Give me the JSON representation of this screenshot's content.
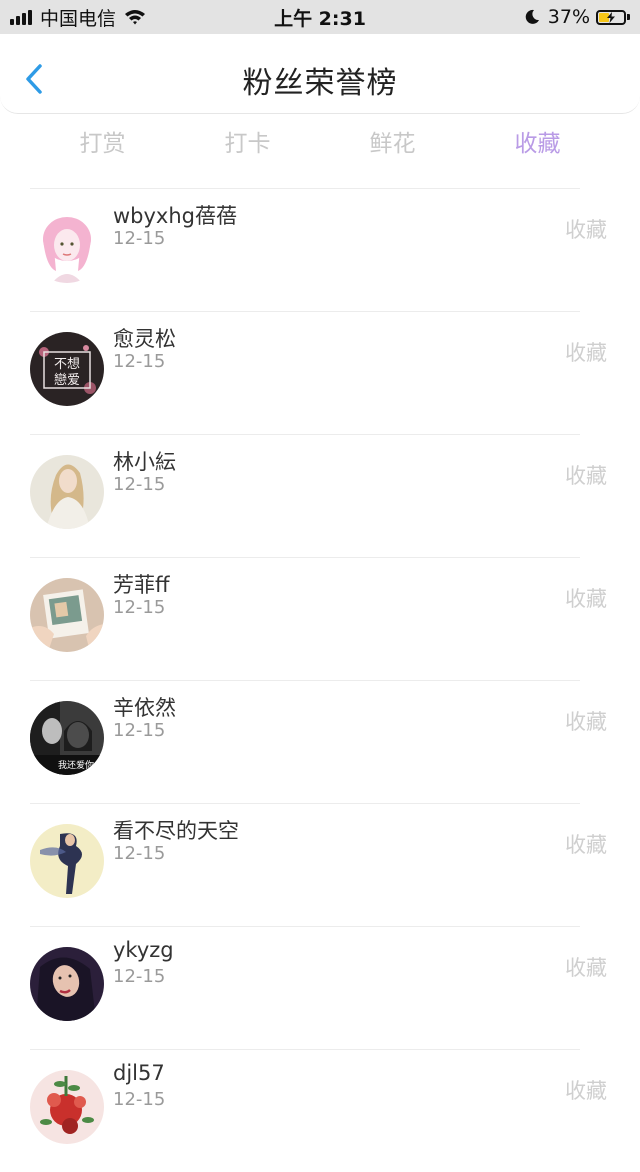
{
  "status_bar": {
    "carrier": "中国电信",
    "time": "上午 2:31",
    "battery": "37%",
    "battery_level": 0.37,
    "icons": [
      "signal-icon",
      "wifi-icon",
      "moon-icon",
      "battery-icon"
    ]
  },
  "header": {
    "title": "粉丝荣誉榜",
    "back_icon": "chevron-left-icon"
  },
  "tabs": [
    {
      "label": "打赏",
      "active": false
    },
    {
      "label": "打卡",
      "active": false
    },
    {
      "label": "鲜花",
      "active": false
    },
    {
      "label": "收藏",
      "active": true
    }
  ],
  "colors": {
    "accent": "#b99be6",
    "back_icon": "#2e9be6",
    "tab_inactive": "#c8c8c8",
    "date_text": "#9a9a9a",
    "action_text": "#cfcfcf"
  },
  "fans": [
    {
      "name": "wbyxhg蓓蓓",
      "date": "12-15",
      "action": "收藏",
      "avatar": "avatar-illustrated-pink-hair"
    },
    {
      "name": "愈灵松",
      "date": "12-15",
      "action": "收藏",
      "avatar": "avatar-text-image",
      "avatar_text_1": "不想",
      "avatar_text_2": "戀爱"
    },
    {
      "name": "林小紜",
      "date": "12-15",
      "action": "收藏",
      "avatar": "avatar-photo-woman-blonde"
    },
    {
      "name": "芳菲ff",
      "date": "12-15",
      "action": "收藏",
      "avatar": "avatar-photo-polaroid"
    },
    {
      "name": "辛依然",
      "date": "12-15",
      "action": "收藏",
      "avatar": "avatar-photo-bw",
      "avatar_text": "我还爱你"
    },
    {
      "name": "看不尽的天空",
      "date": "12-15",
      "action": "收藏",
      "avatar": "avatar-photo-dancer"
    },
    {
      "name": "ykyzg",
      "date": "12-15",
      "action": "收藏",
      "avatar": "avatar-photo-woman-dark"
    },
    {
      "name": "djl57",
      "date": "12-15",
      "action": "收藏",
      "avatar": "avatar-photo-flowers"
    }
  ]
}
